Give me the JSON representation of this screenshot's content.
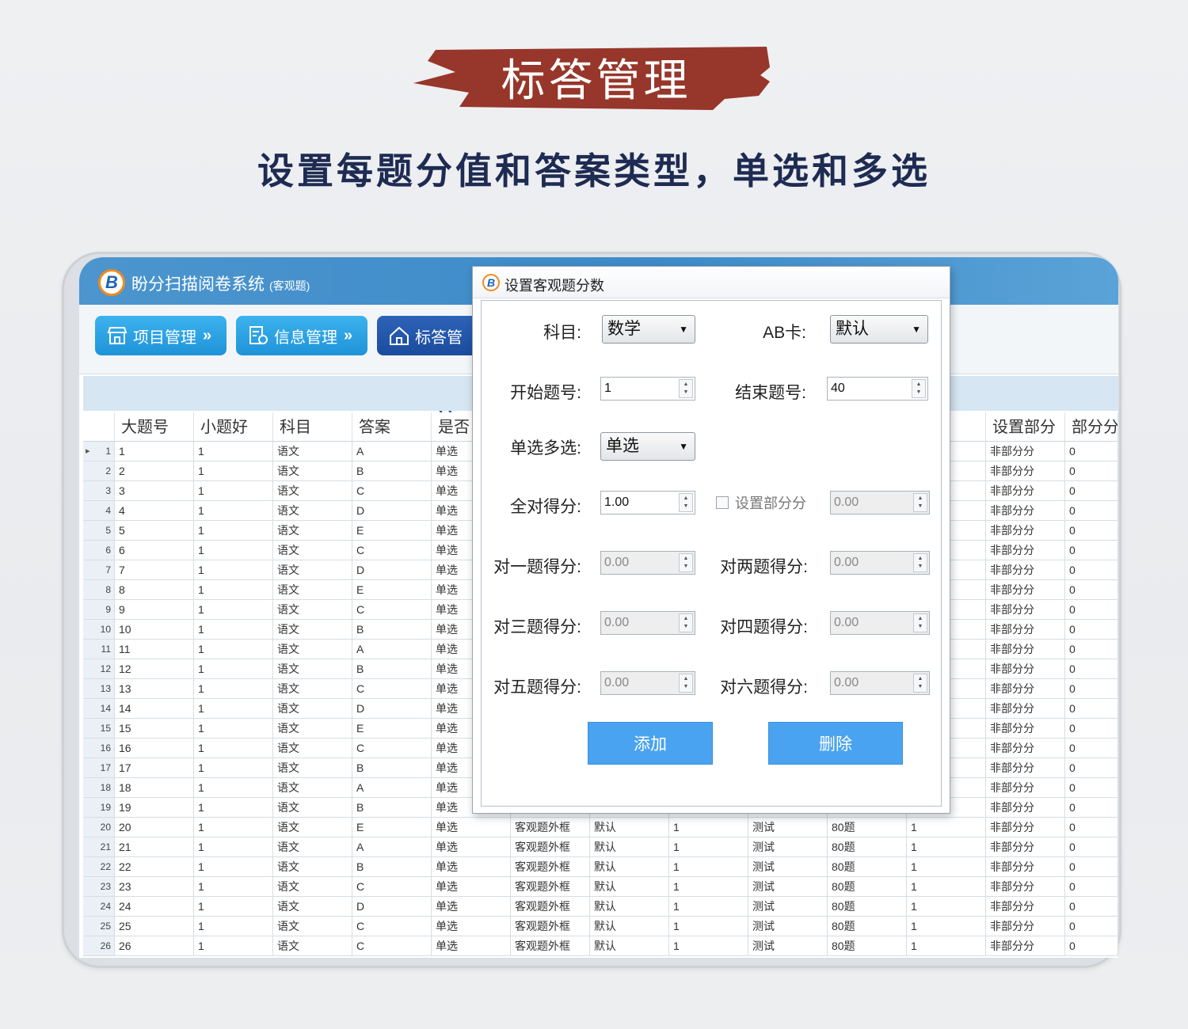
{
  "banner": {
    "title": "标答管理"
  },
  "subtitle": "设置每题分值和答案类型，单选和多选",
  "app": {
    "logo": "B",
    "title": "盼分扫描阅卷系统",
    "title_suffix": "(客观题)"
  },
  "toolbar": {
    "buttons": [
      {
        "label": "项目管理",
        "chevron": "»"
      },
      {
        "label": "信息管理",
        "chevron": "»"
      },
      {
        "label": "标答管"
      }
    ]
  },
  "table": {
    "headers": [
      "",
      "大题号",
      "小题好",
      "科目",
      "答案",
      "是否",
      "",
      "",
      "",
      "",
      "",
      "",
      "设置部分",
      "部分分"
    ],
    "rows": [
      [
        "1",
        "1",
        "1",
        "语文",
        "A",
        "单选",
        "",
        "",
        "",
        "",
        "",
        "",
        "非部分分",
        "0"
      ],
      [
        "2",
        "2",
        "1",
        "语文",
        "B",
        "单选",
        "",
        "",
        "",
        "",
        "",
        "",
        "非部分分",
        "0"
      ],
      [
        "3",
        "3",
        "1",
        "语文",
        "C",
        "单选",
        "",
        "",
        "",
        "",
        "",
        "",
        "非部分分",
        "0"
      ],
      [
        "4",
        "4",
        "1",
        "语文",
        "D",
        "单选",
        "",
        "",
        "",
        "",
        "",
        "",
        "非部分分",
        "0"
      ],
      [
        "5",
        "5",
        "1",
        "语文",
        "E",
        "单选",
        "",
        "",
        "",
        "",
        "",
        "",
        "非部分分",
        "0"
      ],
      [
        "6",
        "6",
        "1",
        "语文",
        "C",
        "单选",
        "",
        "",
        "",
        "",
        "",
        "",
        "非部分分",
        "0"
      ],
      [
        "7",
        "7",
        "1",
        "语文",
        "D",
        "单选",
        "",
        "",
        "",
        "",
        "",
        "",
        "非部分分",
        "0"
      ],
      [
        "8",
        "8",
        "1",
        "语文",
        "E",
        "单选",
        "",
        "",
        "",
        "",
        "",
        "",
        "非部分分",
        "0"
      ],
      [
        "9",
        "9",
        "1",
        "语文",
        "C",
        "单选",
        "",
        "",
        "",
        "",
        "",
        "",
        "非部分分",
        "0"
      ],
      [
        "10",
        "10",
        "1",
        "语文",
        "B",
        "单选",
        "",
        "",
        "",
        "",
        "",
        "",
        "非部分分",
        "0"
      ],
      [
        "11",
        "11",
        "1",
        "语文",
        "A",
        "单选",
        "",
        "",
        "",
        "",
        "",
        "",
        "非部分分",
        "0"
      ],
      [
        "12",
        "12",
        "1",
        "语文",
        "B",
        "单选",
        "",
        "",
        "",
        "",
        "",
        "",
        "非部分分",
        "0"
      ],
      [
        "13",
        "13",
        "1",
        "语文",
        "C",
        "单选",
        "",
        "",
        "",
        "",
        "",
        "",
        "非部分分",
        "0"
      ],
      [
        "14",
        "14",
        "1",
        "语文",
        "D",
        "单选",
        "",
        "",
        "",
        "",
        "",
        "",
        "非部分分",
        "0"
      ],
      [
        "15",
        "15",
        "1",
        "语文",
        "E",
        "单选",
        "",
        "",
        "",
        "",
        "",
        "",
        "非部分分",
        "0"
      ],
      [
        "16",
        "16",
        "1",
        "语文",
        "C",
        "单选",
        "",
        "",
        "",
        "",
        "",
        "",
        "非部分分",
        "0"
      ],
      [
        "17",
        "17",
        "1",
        "语文",
        "B",
        "单选",
        "",
        "",
        "",
        "",
        "",
        "",
        "非部分分",
        "0"
      ],
      [
        "18",
        "18",
        "1",
        "语文",
        "A",
        "单选",
        "",
        "",
        "",
        "",
        "",
        "",
        "非部分分",
        "0"
      ],
      [
        "19",
        "19",
        "1",
        "语文",
        "B",
        "单选",
        "",
        "",
        "",
        "",
        "",
        "",
        "非部分分",
        "0"
      ],
      [
        "20",
        "20",
        "1",
        "语文",
        "E",
        "单选",
        "客观题外框",
        "默认",
        "1",
        "测试",
        "80题",
        "1",
        "非部分分",
        "0"
      ],
      [
        "21",
        "21",
        "1",
        "语文",
        "A",
        "单选",
        "客观题外框",
        "默认",
        "1",
        "测试",
        "80题",
        "1",
        "非部分分",
        "0"
      ],
      [
        "22",
        "22",
        "1",
        "语文",
        "B",
        "单选",
        "客观题外框",
        "默认",
        "1",
        "测试",
        "80题",
        "1",
        "非部分分",
        "0"
      ],
      [
        "23",
        "23",
        "1",
        "语文",
        "C",
        "单选",
        "客观题外框",
        "默认",
        "1",
        "测试",
        "80题",
        "1",
        "非部分分",
        "0"
      ],
      [
        "24",
        "24",
        "1",
        "语文",
        "D",
        "单选",
        "客观题外框",
        "默认",
        "1",
        "测试",
        "80题",
        "1",
        "非部分分",
        "0"
      ],
      [
        "25",
        "25",
        "1",
        "语文",
        "C",
        "单选",
        "客观题外框",
        "默认",
        "1",
        "测试",
        "80题",
        "1",
        "非部分分",
        "0"
      ],
      [
        "26",
        "26",
        "1",
        "语文",
        "C",
        "单选",
        "客观题外框",
        "默认",
        "1",
        "测试",
        "80题",
        "1",
        "非部分分",
        "0"
      ]
    ]
  },
  "dialog": {
    "title": "设置客观题分数",
    "subject_label": "科目:",
    "subject_value": "数学",
    "abcard_label": "AB卡:",
    "abcard_value": "默认",
    "start_label": "开始题号:",
    "start_value": "1",
    "end_label": "结束题号:",
    "end_value": "40",
    "type_label": "单选多选:",
    "type_value": "单选",
    "full_label": "全对得分:",
    "full_value": "1.00",
    "partial_check_label": "设置部分分",
    "partial_value": "0.00",
    "one_label": "对一题得分:",
    "one_value": "0.00",
    "two_label": "对两题得分:",
    "two_value": "0.00",
    "three_label": "对三题得分:",
    "three_value": "0.00",
    "four_label": "对四题得分:",
    "four_value": "0.00",
    "five_label": "对五题得分:",
    "five_value": "0.00",
    "six_label": "对六题得分:",
    "six_value": "0.00",
    "add_label": "添加",
    "delete_label": "删除"
  },
  "colors": {
    "banner": "#97362a",
    "header": "#3d8bc9",
    "button": "#1f93d8",
    "button_active": "#1b4c9d",
    "dialog_button": "#4aa3f0",
    "subtitle": "#1e2b52"
  }
}
